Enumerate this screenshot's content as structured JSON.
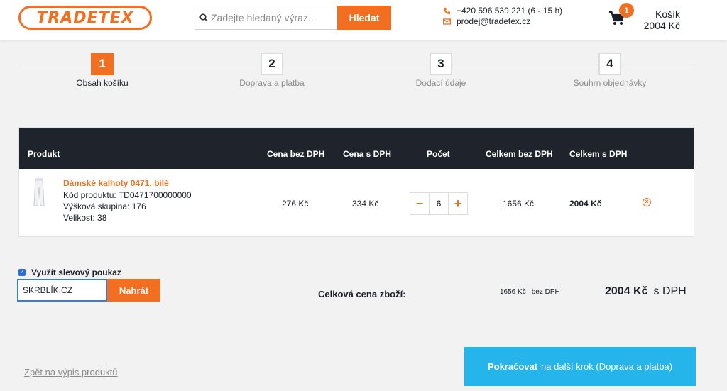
{
  "header": {
    "logo_text": "TRADETEX",
    "search_placeholder": "Zadejte hledaný výraz...",
    "search_button": "Hledat",
    "phone": "+420 596 539 221 (6 - 15 h)",
    "email": "prodej@tradetex.cz",
    "cart_label": "Košík",
    "cart_total": "2004 Kč",
    "cart_count": "1"
  },
  "steps": [
    {
      "num": "1",
      "label": "Obsah košíku",
      "active": true
    },
    {
      "num": "2",
      "label": "Doprava a platba",
      "active": false
    },
    {
      "num": "3",
      "label": "Dodací údaje",
      "active": false
    },
    {
      "num": "4",
      "label": "Souhrn objednávky",
      "active": false
    }
  ],
  "table": {
    "headers": {
      "product": "Produkt",
      "price_net": "Cena bez DPH",
      "price_gross": "Cena s DPH",
      "quantity": "Počet",
      "total_net": "Celkem bez DPH",
      "total_gross": "Celkem s DPH"
    },
    "items": [
      {
        "name": "Dámské kalhoty 0471, bílé",
        "code": "Kód produktu: TD0471700000000",
        "height_group": "Výšková skupina: 176",
        "size": "Velikost: 38",
        "price_net": "276 Kč",
        "price_gross": "334 Kč",
        "quantity": "6",
        "total_net": "1656 Kč",
        "total_gross": "2004 Kč"
      }
    ]
  },
  "voucher": {
    "label": "Využít slevový poukaz",
    "checked": true,
    "value": "SKRBLÍK.CZ",
    "button": "Nahrát"
  },
  "totals": {
    "label": "Celková cena zboží:",
    "net_value": "1656 Kč",
    "net_suffix": "bez DPH",
    "gross_value": "2004 Kč",
    "gross_suffix": "s DPH"
  },
  "footer": {
    "back_link": "Zpět na výpis produktů",
    "continue_bold": "Pokračovat",
    "continue_rest": "na další krok (Doprava a platba)"
  },
  "colors": {
    "accent": "#f26f21",
    "dark_header": "#1f242c",
    "continue_blue": "#26b5ea"
  }
}
